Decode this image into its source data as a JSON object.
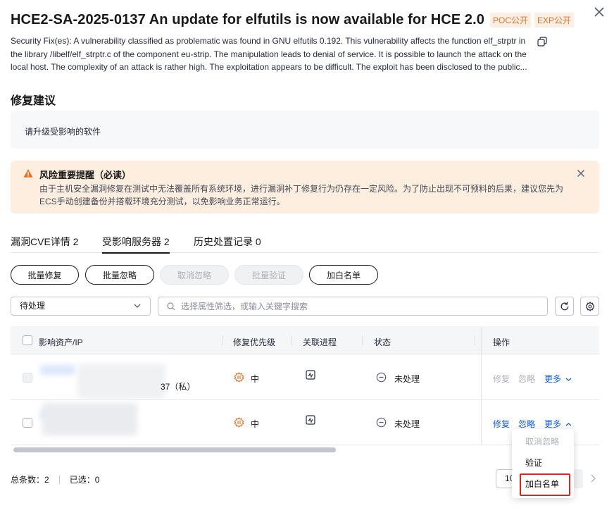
{
  "header": {
    "title": "HCE2-SA-2025-0137 An update for elfutils is now available for HCE 2.0",
    "tags": [
      "POC公开",
      "EXP公开"
    ],
    "description_lines": [
      "Security Fix(es): A vulnerability classified as problematic was found in GNU elfutils 0.192. This vulnerability affects the function elf_strptr in",
      "the library /libelf/elf_strptr.c of the component eu-strip. The manipulation leads to denial of service. It is possible to launch the attack on the",
      "local host. The complexity of an attack is rather high. The exploitation appears to be difficult. The exploit has been disclosed to the public..."
    ]
  },
  "advice": {
    "heading": "修复建议",
    "text": "请升级受影响的软件"
  },
  "warning": {
    "title": "风险重要提醒（必读）",
    "body_lines": [
      "由于主机安全漏洞修复在测试中无法覆盖所有系统环境，进行漏洞补丁修复行为仍存在一定风险。为了防止出现不可预料的后果，建议您先为",
      "ECS手动创建备份并搭载环境充分测试，以免影响业务正常运行。"
    ]
  },
  "tabs": [
    {
      "label": "漏洞CVE详情 2"
    },
    {
      "label": "受影响服务器 2"
    },
    {
      "label": "历史处置记录 0"
    }
  ],
  "toolbar": {
    "batch_fix": "批量修复",
    "batch_ignore": "批量忽略",
    "cancel_ignore": "取消忽略",
    "batch_verify": "批量验证",
    "add_whitelist": "加白名单"
  },
  "filter": {
    "status_selected": "待处理",
    "search_placeholder": "选择属性筛选，或输入关键字搜索"
  },
  "table": {
    "headers": {
      "asset": "影响资产/IP",
      "priority": "修复优先级",
      "process": "关联进程",
      "status": "状态",
      "ops": "操作"
    },
    "rows": [
      {
        "ip_suffix": "37（私）",
        "priority": "中",
        "status": "未处理",
        "op_fix": "修复",
        "op_ignore": "忽略",
        "op_more": "更多",
        "ops_enabled": false
      },
      {
        "ip_suffix": "",
        "priority": "中",
        "status": "未处理",
        "op_fix": "修复",
        "op_ignore": "忽略",
        "op_more": "更多",
        "ops_enabled": true
      }
    ]
  },
  "footer": {
    "total_label": "总条数：2",
    "selected_label": "已选：0",
    "page_size": "10"
  },
  "more_menu": {
    "items": [
      "取消忽略",
      "验证",
      "加白名单"
    ]
  },
  "colors": {
    "accent": "#0a59f7",
    "tag_orange": "#e0732a",
    "warning_bg": "#fdeee0",
    "highlight_red": "#e0241b"
  }
}
